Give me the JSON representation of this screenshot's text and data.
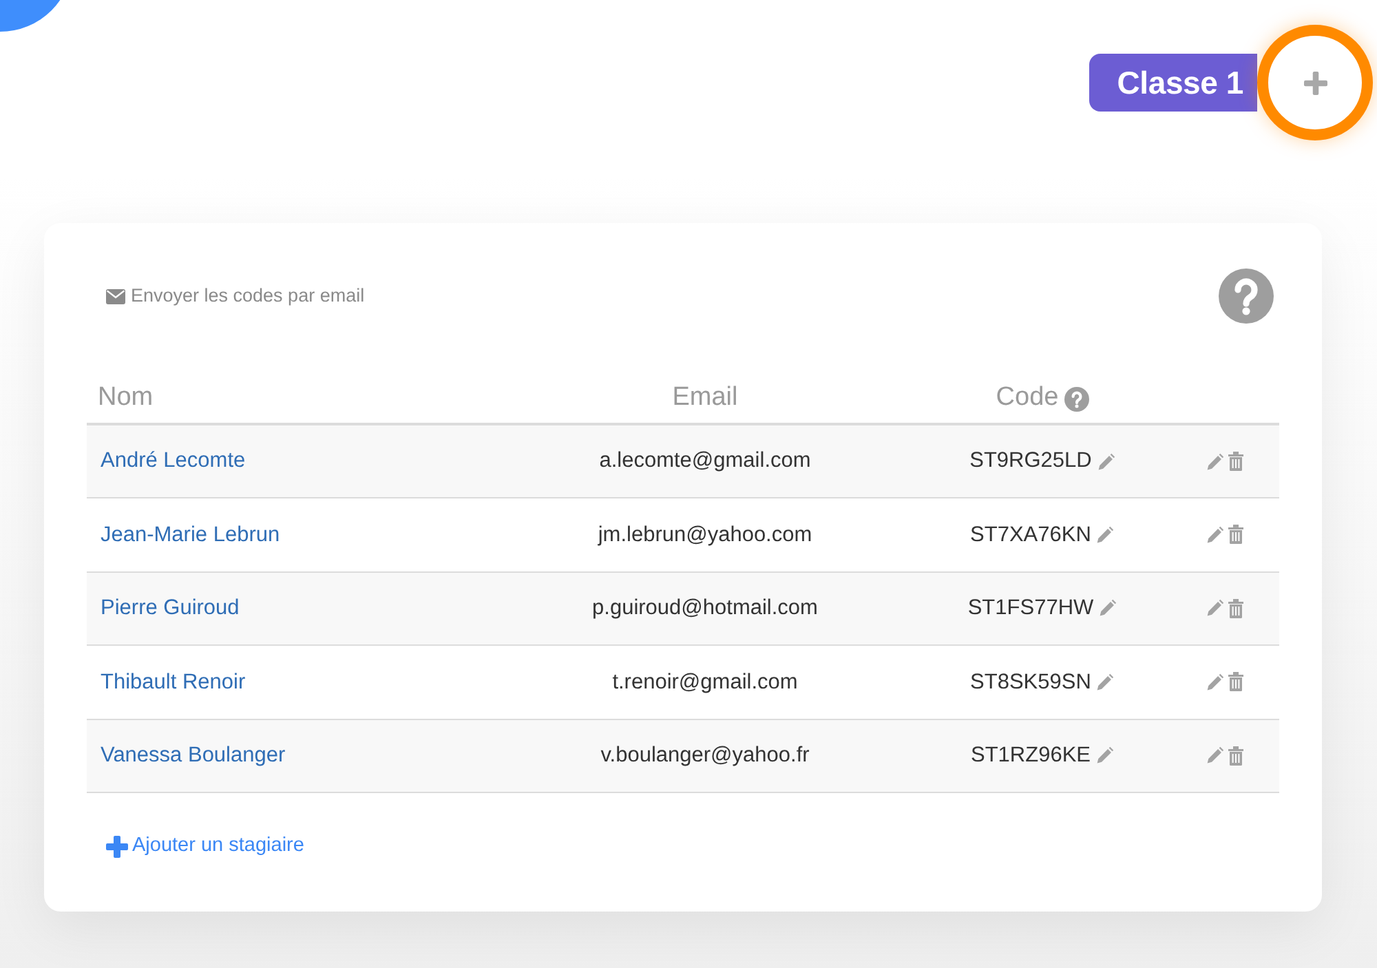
{
  "class_tabs": [
    {
      "label": "Classe 1",
      "selected": true
    }
  ],
  "add_class_button": {
    "highlighted": true
  },
  "card": {
    "send_codes_link": "Envoyer les codes par email",
    "table": {
      "columns": [
        "Nom",
        "Email",
        "Code"
      ],
      "rows": [
        {
          "name": "André Lecomte",
          "email": "a.lecomte@gmail.com",
          "code": "ST9RG25LD"
        },
        {
          "name": "Jean-Marie Lebrun",
          "email": "jm.lebrun@yahoo.com",
          "code": "ST7XA76KN"
        },
        {
          "name": "Pierre Guiroud",
          "email": "p.guiroud@hotmail.com",
          "code": "ST1FS77HW"
        },
        {
          "name": "Thibault Renoir",
          "email": "t.renoir@gmail.com",
          "code": "ST8SK59SN"
        },
        {
          "name": "Vanessa Boulanger",
          "email": "v.boulanger@yahoo.fr",
          "code": "ST1RZ96KE"
        }
      ]
    },
    "add_trainee_link": "Ajouter un stagiaire"
  }
}
